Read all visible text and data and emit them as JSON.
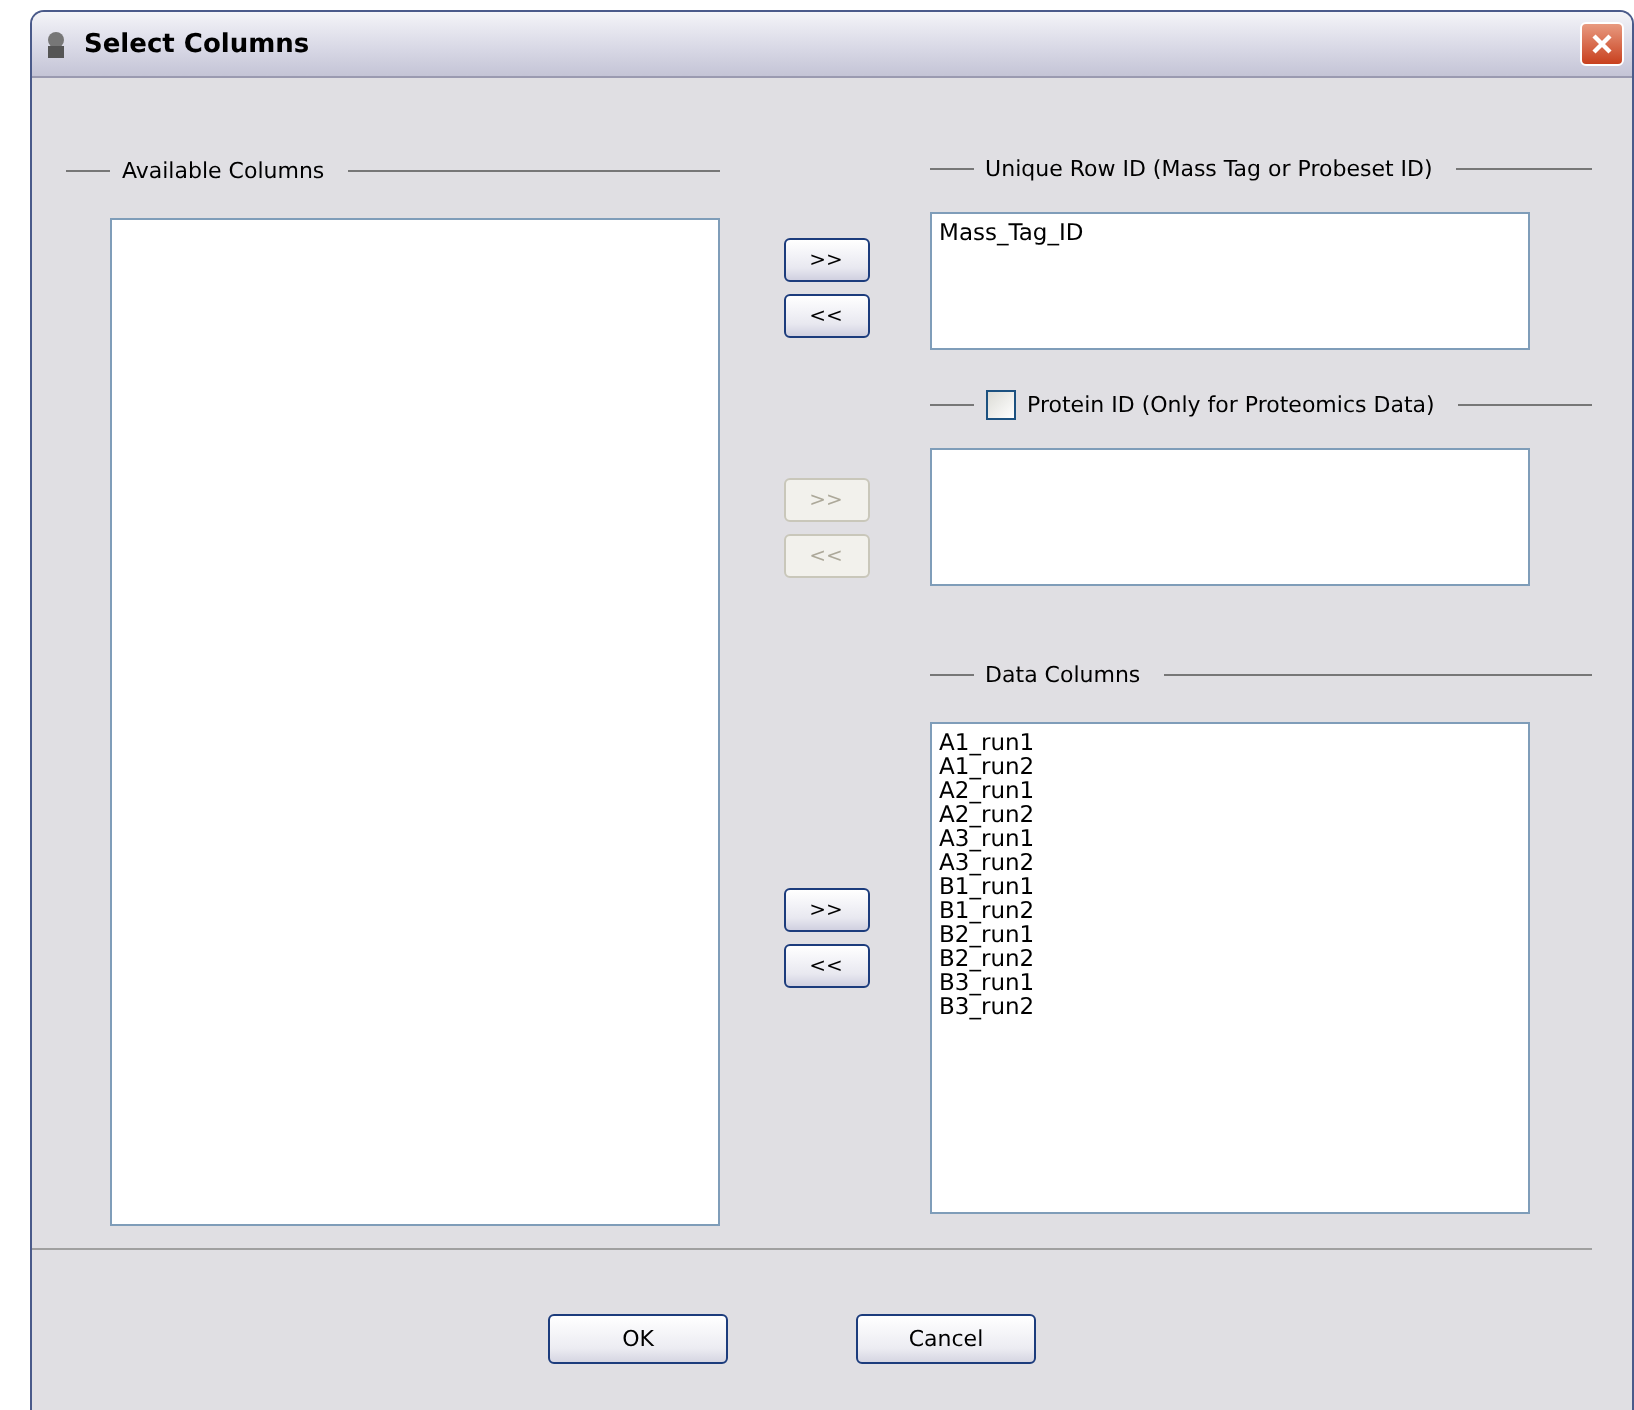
{
  "window": {
    "title": "Select Columns"
  },
  "available_columns": {
    "heading": "Available Columns"
  },
  "unique_row_id": {
    "heading": "Unique Row ID (Mass Tag or Probeset ID)",
    "items": [
      "Mass_Tag_ID"
    ],
    "transfer": [
      {
        "label": ">>",
        "disabled": false
      },
      {
        "label": "<<",
        "disabled": false
      }
    ]
  },
  "protein_id": {
    "label": "Protein ID (Only for Proteomics Data)",
    "checked": false,
    "transfer": [
      {
        "label": ">>",
        "disabled": true
      },
      {
        "label": "<<",
        "disabled": true
      }
    ]
  },
  "data_columns": {
    "heading": "Data Columns",
    "items": [
      "A1_run1",
      "A1_run2",
      "A2_run1",
      "A2_run2",
      "A3_run1",
      "A3_run2",
      "B1_run1",
      "B1_run2",
      "B2_run1",
      "B2_run2",
      "B3_run1",
      "B3_run2"
    ],
    "transfer": [
      {
        "label": ">>",
        "disabled": false
      },
      {
        "label": "<<",
        "disabled": false
      }
    ]
  },
  "buttons": [
    "OK",
    "Cancel"
  ]
}
